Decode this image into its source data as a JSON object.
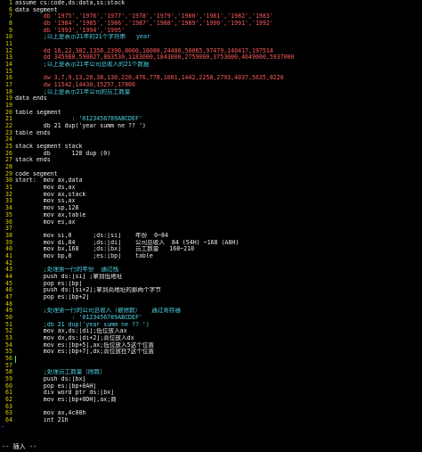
{
  "editor": {
    "lines": [
      {
        "num": "1",
        "text": "assume cs:code,ds:data,ss:stack",
        "color": "white"
      },
      {
        "num": "6",
        "text": "data segment",
        "color": "white"
      },
      {
        "num": "7",
        "text": "        db '1975','1976','1977','1978','1979','1980','1981','1982','1983'",
        "color": "red"
      },
      {
        "num": "8",
        "text": "        db '1984','1985','1986','1987','1988','1989','1990','1991','1992'",
        "color": "red"
      },
      {
        "num": "9",
        "text": "        db '1993','1994','1995'",
        "color": "red"
      },
      {
        "num": "10",
        "text": "        ;以上是表示21年的21个字符串   year",
        "color": "cyan"
      },
      {
        "num": "11",
        "text": "",
        "color": "white"
      },
      {
        "num": "12",
        "text": "        dd 16,22,382,1356,2390,8000,16000,24486,50065,97479,140417,197514",
        "color": "red"
      },
      {
        "num": "13",
        "text": "        dd 345980,590827,803530,1183000,1843000,2759000,3753000,4649000,5937000",
        "color": "red"
      },
      {
        "num": "14",
        "text": "        ;以上是表示21年公司总收入的21个数据",
        "color": "cyan"
      },
      {
        "num": "15",
        "text": "",
        "color": "white"
      },
      {
        "num": "16",
        "text": "        dw 3,7,9,13,28,38,130,220,476,778,1001,1442,2258,2793,4037,5635,8226",
        "color": "red"
      },
      {
        "num": "17",
        "text": "        dw 11542,14430,15257,17800",
        "color": "red"
      },
      {
        "num": "18",
        "text": "        ;以上是表示21年公司的员工数量",
        "color": "cyan"
      },
      {
        "num": "19",
        "text": "data ends",
        "color": "white"
      },
      {
        "num": "19",
        "text": "",
        "color": "white"
      },
      {
        "num": "20",
        "text": "table segment",
        "color": "white"
      },
      {
        "num": "21",
        "text": "                : '0123456789ABCDEF'",
        "color": "cyan"
      },
      {
        "num": "22",
        "text": "        db 21 dup('year summ ne ?? ')",
        "color": "white"
      },
      {
        "num": "23",
        "text": "table ends",
        "color": "white"
      },
      {
        "num": "24",
        "text": "",
        "color": "white"
      },
      {
        "num": "25",
        "text": "stack segment stack",
        "color": "white"
      },
      {
        "num": "26",
        "text": "        db      128 dup (0)",
        "color": "white"
      },
      {
        "num": "27",
        "text": "stack ends",
        "color": "white"
      },
      {
        "num": "28",
        "text": "",
        "color": "white"
      },
      {
        "num": "29",
        "text": "code segment",
        "color": "white"
      },
      {
        "num": "30",
        "text": "start:  mov ax,data",
        "color": "white"
      },
      {
        "num": "31",
        "text": "        mov ds,ax",
        "color": "white"
      },
      {
        "num": "32",
        "text": "        mov ax,stack",
        "color": "white"
      },
      {
        "num": "33",
        "text": "        mov ss,ax",
        "color": "white"
      },
      {
        "num": "34",
        "text": "        mov sp,128",
        "color": "white"
      },
      {
        "num": "35",
        "text": "        mov ax,table",
        "color": "white"
      },
      {
        "num": "36",
        "text": "        mov es,ax",
        "color": "white"
      },
      {
        "num": "37",
        "text": "",
        "color": "white"
      },
      {
        "num": "38",
        "text": "        mov si,0      ;ds:[si]    年份  0~84",
        "color": "white"
      },
      {
        "num": "39",
        "text": "        mov di,84     ;ds:[di]    公司总收入  84 (54H) ~168 (A8H)",
        "color": "white"
      },
      {
        "num": "40",
        "text": "        mov bx,168    ;ds:[bx]    员工数量   168~210",
        "color": "white"
      },
      {
        "num": "41",
        "text": "        mov bp,0      ;es:[bp]    table",
        "color": "white"
      },
      {
        "num": "42",
        "text": "",
        "color": "white"
      },
      {
        "num": "43",
        "text": "        ;处理第一行的年份  通过栈",
        "color": "cyan"
      },
      {
        "num": "44",
        "text": "        push ds:[si] ;拿到低地址",
        "color": "white"
      },
      {
        "num": "45",
        "text": "        pop es:[bp]",
        "color": "white"
      },
      {
        "num": "46",
        "text": "        push ds:[si+2];拿到高地址的那两个字节",
        "color": "white"
      },
      {
        "num": "47",
        "text": "        pop es:[bp+2]",
        "color": "white"
      },
      {
        "num": "48",
        "text": "",
        "color": "white"
      },
      {
        "num": "49",
        "text": "        ;处理第一行的公司总收入（被除数）   通过寄存器",
        "color": "cyan"
      },
      {
        "num": "50",
        "text": "                : '0123456789ABCDEF'",
        "color": "cyan"
      },
      {
        "num": "51",
        "text": "        ;db 21 dup('year summ ne ?? ')",
        "color": "cyan"
      },
      {
        "num": "52",
        "text": "        mov ax,ds:[di];低位放入ax",
        "color": "white"
      },
      {
        "num": "53",
        "text": "        mov dx,ds:[di+2];高位放入dx",
        "color": "white"
      },
      {
        "num": "54",
        "text": "        mov es:[bp+5],ax;低位放入5这个位置",
        "color": "white"
      },
      {
        "num": "55",
        "text": "        mov es:[bp+7],dx;高位放在7这个位置",
        "color": "white"
      },
      {
        "num": "56",
        "text": "",
        "color": "white"
      },
      {
        "num": "57",
        "text": "",
        "color": "white"
      },
      {
        "num": "58",
        "text": "        ;处理员工数量（除数）",
        "color": "cyan"
      },
      {
        "num": "59",
        "text": "        push ds:[bx]",
        "color": "white"
      },
      {
        "num": "60",
        "text": "        pop es:[bp+0AH]",
        "color": "white"
      },
      {
        "num": "61",
        "text": "        div word ptr ds:[bx]",
        "color": "white"
      },
      {
        "num": "62",
        "text": "        mov es:[bp+0DH],ax;商",
        "color": "white"
      },
      {
        "num": "63",
        "text": "",
        "color": "white"
      },
      {
        "num": "63",
        "text": "        mov ax,4c00h",
        "color": "white"
      },
      {
        "num": "64",
        "text": "        int 21h",
        "color": "white"
      },
      {
        "num": "~",
        "text": "",
        "color": "white"
      }
    ]
  },
  "statusbar": {
    "mode": "-- 插入 --"
  },
  "colors": {
    "background": "#000000",
    "line_number": "#d8d000",
    "comment": "#4fd2e6",
    "string": "#ff5a5a",
    "cursor": "#5be05b"
  }
}
